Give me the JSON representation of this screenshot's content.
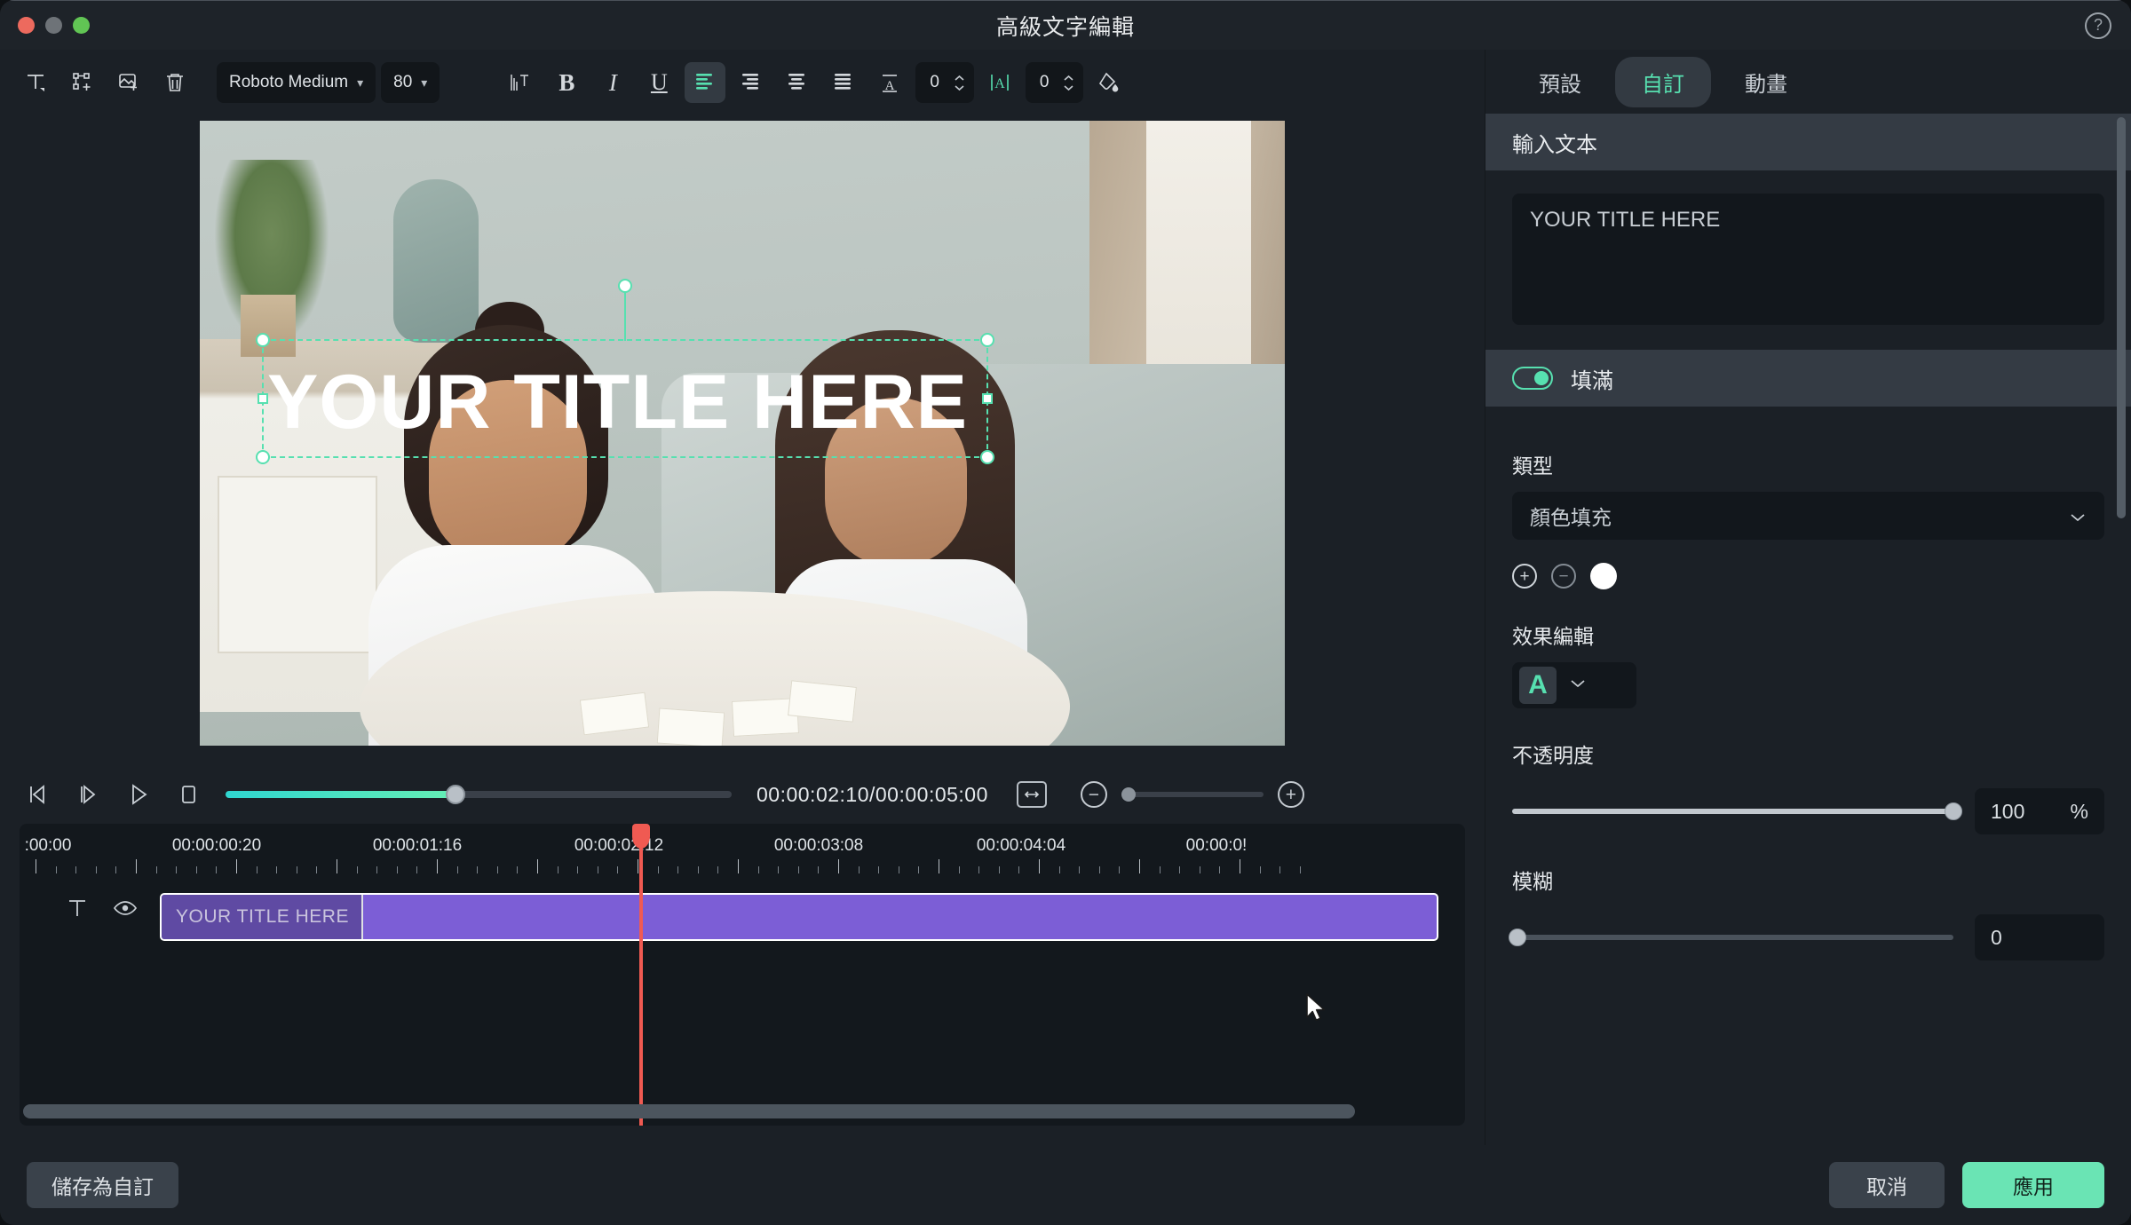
{
  "window": {
    "title": "高級文字編輯",
    "help_icon": "question-mark-icon"
  },
  "toolbar": {
    "buttons": [
      {
        "name": "add-text-icon",
        "label": "T"
      },
      {
        "name": "add-shape-icon",
        "label": ""
      },
      {
        "name": "add-image-icon",
        "label": ""
      },
      {
        "name": "delete-icon",
        "label": ""
      }
    ],
    "font_family": "Roboto Medium",
    "font_size": "80",
    "format": {
      "text_direction": "text-direction-icon",
      "bold": "B",
      "italic": "I",
      "underline": "U",
      "align_left": "align-left-icon",
      "align_right": "align-right-icon",
      "align_center": "align-center-icon",
      "align_justify": "align-justify-icon",
      "line_spacing_icon": "line-height-icon",
      "line_spacing_value": "0",
      "letter_spacing_icon": "letter-spacing-icon",
      "letter_spacing_value": "0",
      "color_picker": "color-fill-icon"
    }
  },
  "preview": {
    "overlay_text": "YOUR TITLE HERE",
    "selection_color": "#57e0b0"
  },
  "transport": {
    "prev_frame": "prev-frame-icon",
    "next_frame": "next-frame-icon",
    "play": "play-icon",
    "stop": "stop-icon",
    "timecode": "00:00:02:10/00:00:05:00",
    "fit_icon": "fit-to-screen-icon",
    "zoom_out": "−",
    "zoom_in": "+"
  },
  "timeline": {
    "ruler_labels": [
      ":00:00",
      "00:00:00:20",
      "00:00:01:16",
      "00:00:02:12",
      "00:00:03:08",
      "00:00:04:04",
      "00:00:0!"
    ],
    "track": {
      "type_icon": "text-track-icon",
      "visibility_icon": "eye-icon",
      "clip_label": "YOUR TITLE HERE",
      "clip_color": "#7c5ed6"
    },
    "playhead_color": "#f05a52"
  },
  "panel": {
    "tabs": [
      {
        "label": "預設",
        "active": false
      },
      {
        "label": "自訂",
        "active": true
      },
      {
        "label": "動畫",
        "active": false
      }
    ],
    "input_text_header": "輸入文本",
    "input_text_value": "YOUR TITLE HERE",
    "fill_header": "填滿",
    "fill_enabled": true,
    "type_label": "類型",
    "type_value": "顏色填充",
    "color_add": "+",
    "color_remove": "−",
    "color_swatch": "#ffffff",
    "effect_label": "效果編輯",
    "effect_glyph": "A",
    "opacity_label": "不透明度",
    "opacity_value": "100",
    "opacity_unit": "%",
    "blur_label": "模糊",
    "blur_value": "0"
  },
  "footer": {
    "save_preset": "儲存為自訂",
    "cancel": "取消",
    "apply": "應用"
  }
}
